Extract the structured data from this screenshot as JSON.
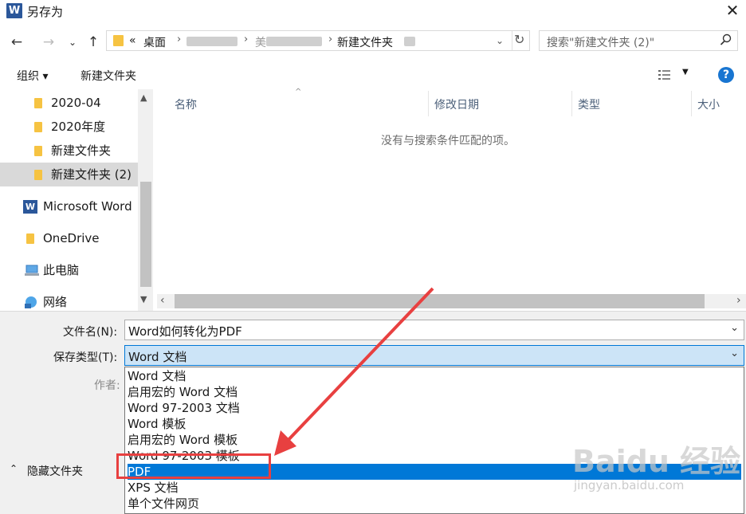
{
  "window": {
    "title": "另存为",
    "app_icon": "W"
  },
  "address": {
    "overflow": "«",
    "crumbs": [
      "桌面",
      "新建文件夹"
    ],
    "crumb_blurred_prefix": "美"
  },
  "search": {
    "placeholder": "搜索\"新建文件夹 (2)\""
  },
  "toolbar": {
    "organize": "组织 ▾",
    "new_folder": "新建文件夹",
    "help": "?"
  },
  "nav": {
    "items": [
      {
        "label": "2020-04"
      },
      {
        "label": "2020年度"
      },
      {
        "label": "新建文件夹"
      },
      {
        "label": "新建文件夹 (2)"
      },
      {
        "label": "Microsoft Word"
      },
      {
        "label": "OneDrive"
      },
      {
        "label": "此电脑"
      },
      {
        "label": "网络"
      }
    ]
  },
  "list": {
    "columns": [
      "名称",
      "修改日期",
      "类型",
      "大小"
    ],
    "empty_message": "没有与搜索条件匹配的项。"
  },
  "form": {
    "filename_label": "文件名(N):",
    "filename_value": "Word如何转化为PDF",
    "type_label": "保存类型(T):",
    "type_value": "Word 文档",
    "author_label": "作者:",
    "hide_folders": "隐藏文件夹"
  },
  "type_options": [
    "Word 文档",
    "启用宏的 Word 文档",
    "Word 97-2003 文档",
    "Word 模板",
    "启用宏的 Word 模板",
    "Word 97-2003 模板",
    "PDF",
    "XPS 文档",
    "单个文件网页"
  ],
  "selected_option_index": 6,
  "watermark": {
    "main": "Baidu 经验",
    "sub": "jingyan.baidu.com"
  },
  "colors": {
    "accent": "#0078d7",
    "annotation": "#e84040",
    "folder": "#f6c342"
  }
}
